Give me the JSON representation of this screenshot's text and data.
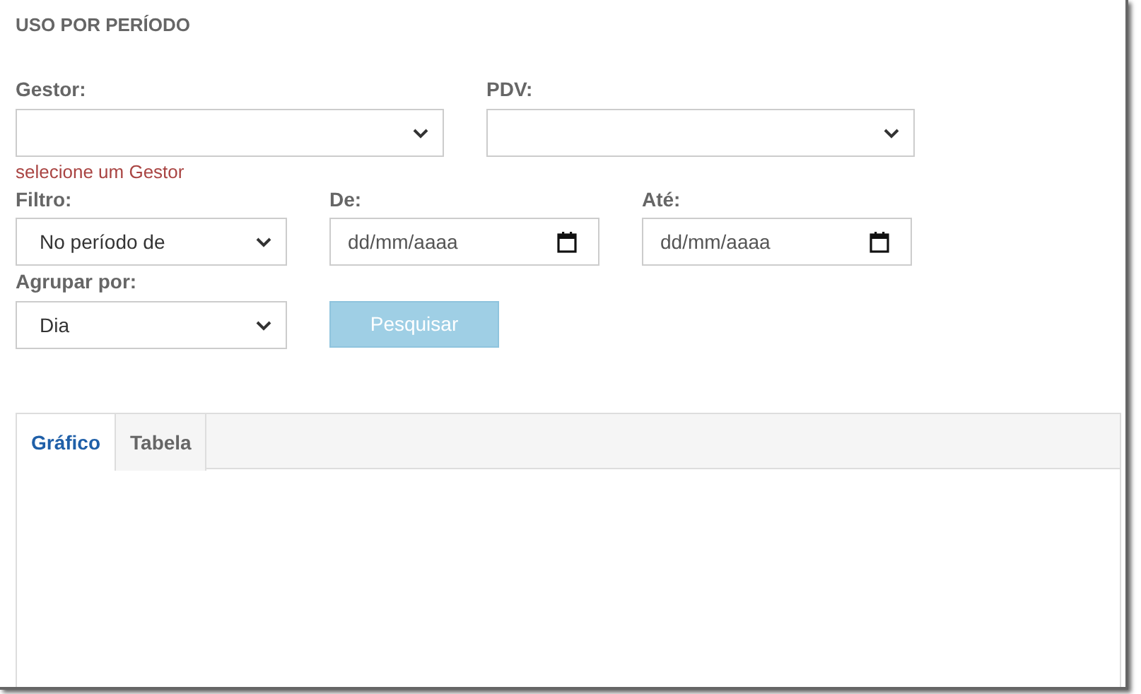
{
  "title": "USO POR PERÍODO",
  "gestor": {
    "label": "Gestor:",
    "error": "selecione um Gestor"
  },
  "pdv": {
    "label": "PDV:"
  },
  "filtro": {
    "label": "Filtro:",
    "value": "No período de"
  },
  "de": {
    "label": "De:",
    "placeholder": "dd/mm/aaaa"
  },
  "ate": {
    "label": "Até:",
    "placeholder": "dd/mm/aaaa"
  },
  "agrupar": {
    "label": "Agrupar por:",
    "value": "Dia"
  },
  "search_button": {
    "label": "Pesquisar",
    "disabled": true
  },
  "tabs": [
    {
      "label": "Gráfico",
      "selected": true
    },
    {
      "label": "Tabela",
      "selected": false
    }
  ]
}
